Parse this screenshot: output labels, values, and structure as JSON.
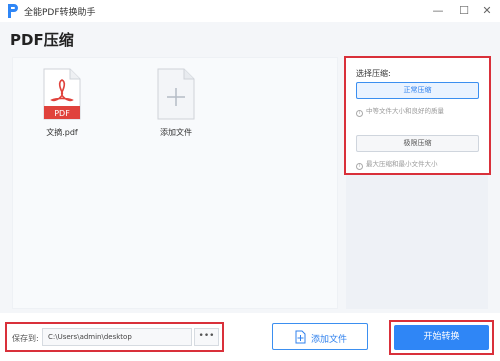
{
  "window": {
    "title": "全能PDF转换助手",
    "minimize_glyph": "—",
    "maximize_glyph": "☐",
    "close_glyph": "✕"
  },
  "page": {
    "title": "PDF压缩"
  },
  "files": [
    {
      "name": "文摘.pdf",
      "badge": "PDF",
      "icon": "pdf-file-icon"
    },
    {
      "name": "添加文件",
      "icon": "add-file-icon"
    }
  ],
  "options": {
    "heading": "选择压缩:",
    "normal": {
      "label": "正常压缩",
      "hint": "中等文件大小和良好的质量",
      "selected": true
    },
    "extreme": {
      "label": "极限压缩",
      "hint": "最大压缩和最小文件大小",
      "selected": false
    }
  },
  "save": {
    "label": "保存到:",
    "path": "C:\\Users\\admin\\desktop",
    "browse": "•••"
  },
  "actions": {
    "add_file": "添加文件",
    "start": "开始转换"
  },
  "colors": {
    "accent": "#2f86f6",
    "highlight_border": "#d9303a",
    "pdf_red": "#e0423c"
  }
}
